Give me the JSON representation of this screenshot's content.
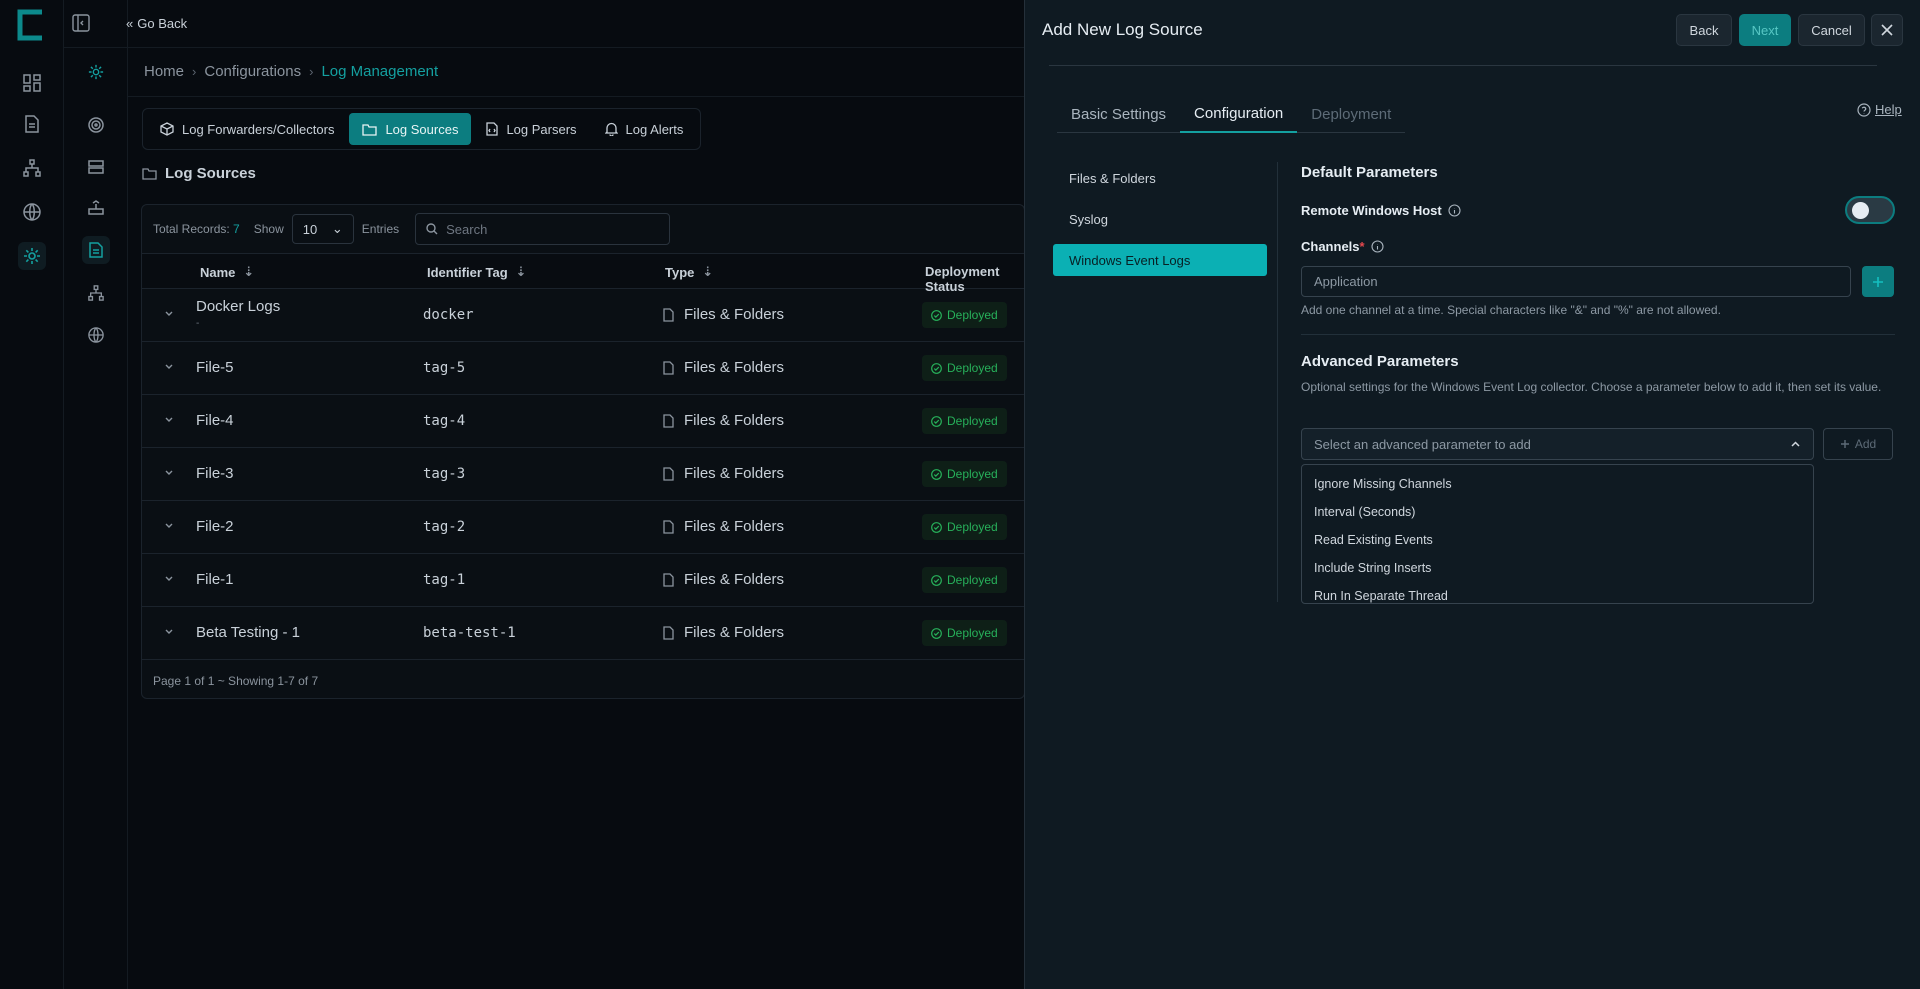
{
  "topbar": {
    "go_back": "Go Back"
  },
  "breadcrumb": [
    "Home",
    "Configurations",
    "Log Management"
  ],
  "tabs": [
    {
      "label": "Log Forwarders/Collectors",
      "icon": "package-icon"
    },
    {
      "label": "Log Sources",
      "icon": "folder-icon",
      "active": true
    },
    {
      "label": "Log Parsers",
      "icon": "code-file-icon"
    },
    {
      "label": "Log Alerts",
      "icon": "bell-icon"
    }
  ],
  "section_title": "Log Sources",
  "table": {
    "total_label": "Total Records:",
    "total_value": "7",
    "show_label": "Show",
    "page_size": "10",
    "entries_label": "Entries",
    "search_placeholder": "Search",
    "columns": [
      "Name",
      "Identifier Tag",
      "Type",
      "Deployment Status"
    ],
    "rows": [
      {
        "name": "Docker Logs",
        "sub": "-",
        "tag": "docker",
        "type": "Files & Folders",
        "status": "Deployed"
      },
      {
        "name": "File-5",
        "tag": "tag-5",
        "type": "Files & Folders",
        "status": "Deployed"
      },
      {
        "name": "File-4",
        "tag": "tag-4",
        "type": "Files & Folders",
        "status": "Deployed"
      },
      {
        "name": "File-3",
        "tag": "tag-3",
        "type": "Files & Folders",
        "status": "Deployed"
      },
      {
        "name": "File-2",
        "tag": "tag-2",
        "type": "Files & Folders",
        "status": "Deployed"
      },
      {
        "name": "File-1",
        "tag": "tag-1",
        "type": "Files & Folders",
        "status": "Deployed"
      },
      {
        "name": "Beta Testing - 1",
        "tag": "beta-test-1",
        "type": "Files & Folders",
        "status": "Deployed"
      }
    ],
    "footer": "Page 1 of 1 ~ Showing 1-7 of 7"
  },
  "drawer": {
    "title": "Add New Log Source",
    "back": "Back",
    "next": "Next",
    "cancel": "Cancel",
    "tabs": [
      "Basic Settings",
      "Configuration",
      "Deployment"
    ],
    "help": "Help",
    "nav": [
      "Files & Folders",
      "Syslog",
      "Windows Event Logs"
    ],
    "default_params": "Default Parameters",
    "remote_host_label": "Remote Windows Host",
    "remote_host_enabled": false,
    "channels_label": "Channels",
    "channels_required": "*",
    "channel_value": "Application",
    "channel_hint": "Add one channel at a time. Special characters like \"&\" and \"%\" are not allowed.",
    "advanced_params": "Advanced Parameters",
    "advanced_hint": "Optional settings for the Windows Event Log collector. Choose a parameter below to add it, then set its value.",
    "select_placeholder": "Select an advanced parameter to add",
    "add_label": "Add",
    "options": [
      "Ignore Missing Channels",
      "Interval (Seconds)",
      "Read Existing Events",
      "Include String Inserts",
      "Run In Separate Thread"
    ]
  },
  "colors": {
    "accent": "#0c7d80",
    "accent_bright": "#14a0a0",
    "success": "#27b05a",
    "background": "#070b10",
    "drawer": "#0f1a22"
  }
}
